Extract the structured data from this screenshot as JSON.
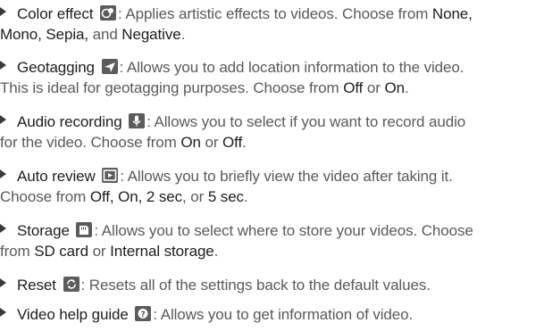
{
  "items": [
    {
      "title": "Color effect",
      "icon": "color-effect-icon",
      "desc1": ": Applies artistic effects to videos. Choose from ",
      "opt1": "None,",
      "l2a": "Mono, Sepia,",
      "l2b": " and ",
      "l2c": "Negative",
      "l2d": "."
    },
    {
      "title": "Geotagging",
      "icon": "geotagging-icon",
      "desc1": ": Allows you to add location information to the video.",
      "l2a": "This is ideal for geotagging purposes. Choose from ",
      "l2b": "Off",
      "l2c": " or ",
      "l2d": "On",
      "l2e": "."
    },
    {
      "title": "Audio recording",
      "icon": "audio-recording-icon",
      "desc1": ": Allows you to select if you want to record audio",
      "l2a": "for the video. Choose from ",
      "l2b": "On",
      "l2c": " or ",
      "l2d": "Off",
      "l2e": "."
    },
    {
      "title": "Auto review",
      "icon": "auto-review-icon",
      "desc1": ": Allows you to briefly view the video after taking it.",
      "l2a": "Choose from ",
      "l2b": "Off, On, 2 sec",
      "l2c": ", or ",
      "l2d": "5 sec",
      "l2e": "."
    },
    {
      "title": "Storage",
      "icon": "storage-icon",
      "desc1": ": Allows you to select where to store your videos. Choose",
      "l2a": "from ",
      "l2b": "SD card",
      "l2c": " or ",
      "l2d": "Internal storage",
      "l2e": "."
    },
    {
      "title": "Reset",
      "icon": "reset-icon",
      "desc1": ": Resets all of the settings back to the default values."
    },
    {
      "title": "Video help guide",
      "icon": "help-icon",
      "desc1": ": Allows you to get information of video."
    }
  ]
}
